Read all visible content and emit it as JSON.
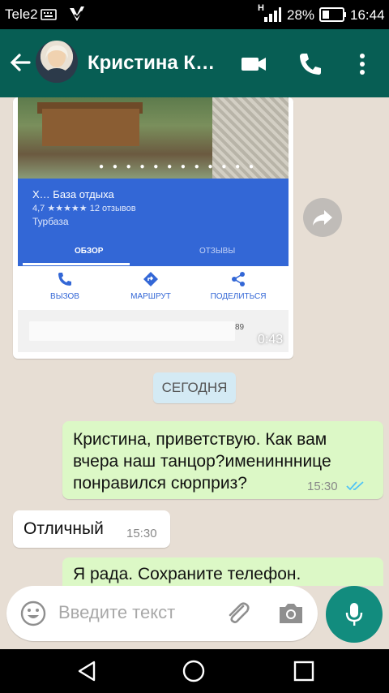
{
  "statusbar": {
    "carrier": "Tele2",
    "battery": "28%",
    "time": "16:44",
    "network": "H"
  },
  "header": {
    "contact_name": "Кристина К…"
  },
  "shared_place": {
    "title": "Х…  База отдыха",
    "rating": "4,7 ★★★★★ 12 отзывов",
    "type": "Турбаза",
    "tab_overview": "ОБЗОР",
    "tab_reviews": "ОТЗЫВЫ",
    "action_call": "ВЫЗОВ",
    "action_route": "МАРШРУТ",
    "action_share": "ПОДЕЛИТЬСЯ",
    "address_suffix": "89",
    "video_duration": "0:43"
  },
  "date_divider": "СЕГОДНЯ",
  "messages": [
    {
      "direction": "out",
      "text": "Кристина, приветствую. Как вам вчера наш танцор?именинннице понравился сюрприз?",
      "time": "15:30",
      "status": "read"
    },
    {
      "direction": "in",
      "text": "Отличный",
      "time": "15:30"
    },
    {
      "direction": "out",
      "text": "Я рада. Сохраните телефон."
    }
  ],
  "composer": {
    "placeholder": "Введите текст"
  },
  "colors": {
    "header": "#075E54",
    "accent": "#128C7E",
    "outgoing_bubble": "#dcf8c6",
    "read_ticks": "#4fc3f7"
  }
}
